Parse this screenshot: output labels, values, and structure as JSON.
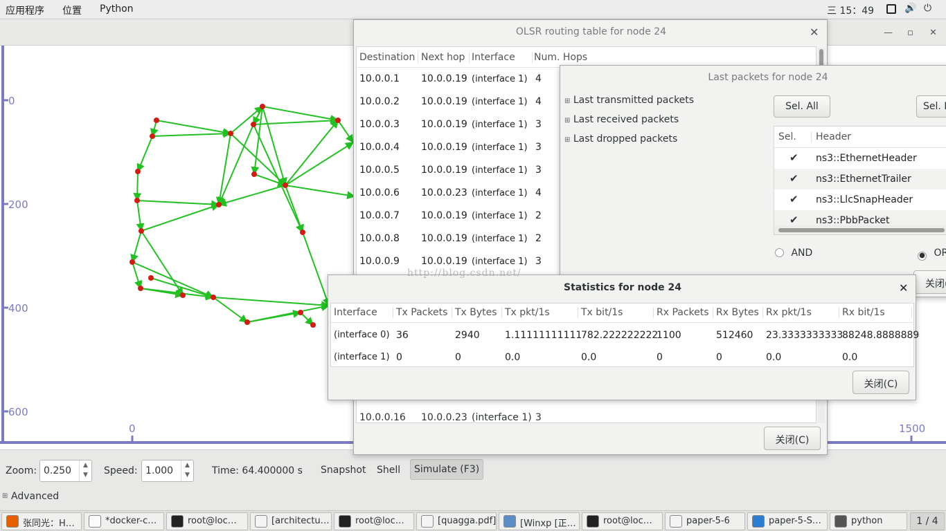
{
  "topbar": {
    "applications": "应用程序",
    "places": "位置",
    "app_name": "Python",
    "clock": "三 15：49"
  },
  "axis": {
    "y_ticks": [
      "0",
      "200",
      "400",
      "600"
    ],
    "x_ticks": [
      "0",
      "1500"
    ]
  },
  "controls": {
    "zoom_label": "Zoom:",
    "zoom_value": "0.250",
    "speed_label": "Speed:",
    "speed_value": "1.000",
    "time_text": "Time: 64.400000 s",
    "snapshot": "Snapshot",
    "shell": "Shell",
    "simulate": "Simulate (F3)",
    "advanced": "Advanced"
  },
  "routing": {
    "title": "OLSR routing table for node 24",
    "headers": [
      "Destination",
      "Next hop",
      "Interface",
      "Num. Hops"
    ],
    "rows": [
      [
        "10.0.0.1",
        "10.0.0.19",
        "(interface 1)",
        "4"
      ],
      [
        "10.0.0.2",
        "10.0.0.19",
        "(interface 1)",
        "4"
      ],
      [
        "10.0.0.3",
        "10.0.0.19",
        "(interface 1)",
        "3"
      ],
      [
        "10.0.0.4",
        "10.0.0.19",
        "(interface 1)",
        "3"
      ],
      [
        "10.0.0.5",
        "10.0.0.19",
        "(interface 1)",
        "3"
      ],
      [
        "10.0.0.6",
        "10.0.0.23",
        "(interface 1)",
        "4"
      ],
      [
        "10.0.0.7",
        "10.0.0.19",
        "(interface 1)",
        "2"
      ],
      [
        "10.0.0.8",
        "10.0.0.19",
        "(interface 1)",
        "2"
      ],
      [
        "10.0.0.9",
        "10.0.0.19",
        "(interface 1)",
        "3"
      ]
    ],
    "bottom_row": [
      "10.0.0.16",
      "10.0.0.23",
      "(interface 1)",
      "3"
    ],
    "close": "关闭(C)"
  },
  "packets": {
    "title": "Last packets for node 24",
    "tree": [
      "Last transmitted packets",
      "Last received packets",
      "Last dropped packets"
    ],
    "sel_all": "Sel. All",
    "sel_none": "Sel. N",
    "col_sel": "Sel.",
    "col_header": "Header",
    "headers": [
      "ns3::EthernetHeader",
      "ns3::EthernetTrailer",
      "ns3::LlcSnapHeader",
      "ns3::PbbPacket"
    ],
    "and": "AND",
    "or": "OR",
    "close": "关闭("
  },
  "stats": {
    "title": "Statistics for node 24",
    "headers": [
      "Interface",
      "Tx Packets",
      "Tx Bytes",
      "Tx pkt/1s",
      "Tx bit/1s",
      "Rx Packets",
      "Rx Bytes",
      "Rx pkt/1s",
      "Rx bit/1s"
    ],
    "rows": [
      [
        "(interface 0)",
        "36",
        "2940",
        "1.11111111111",
        "782.222222222",
        "1100",
        "512460",
        "23.3333333333",
        "88248.8888889"
      ],
      [
        "(interface 1)",
        "0",
        "0",
        "0.0",
        "0.0",
        "0",
        "0",
        "0.0",
        "0.0"
      ]
    ],
    "close": "关闭(C)"
  },
  "watermark": "http://blog.csdn.net/",
  "taskbar": {
    "items": [
      "张同光：H…",
      "*docker-c…",
      "root@loc…",
      "[architectu…",
      "root@loc…",
      "[quagga.pdf]",
      "[Winxp [正…",
      "root@loc…",
      "paper-5-6",
      "paper-5-S…",
      "python"
    ],
    "pager": "1 / 4"
  },
  "colors": {
    "edge": "#22c122",
    "node": "#d21c12",
    "axis": "#7b7bc4"
  }
}
